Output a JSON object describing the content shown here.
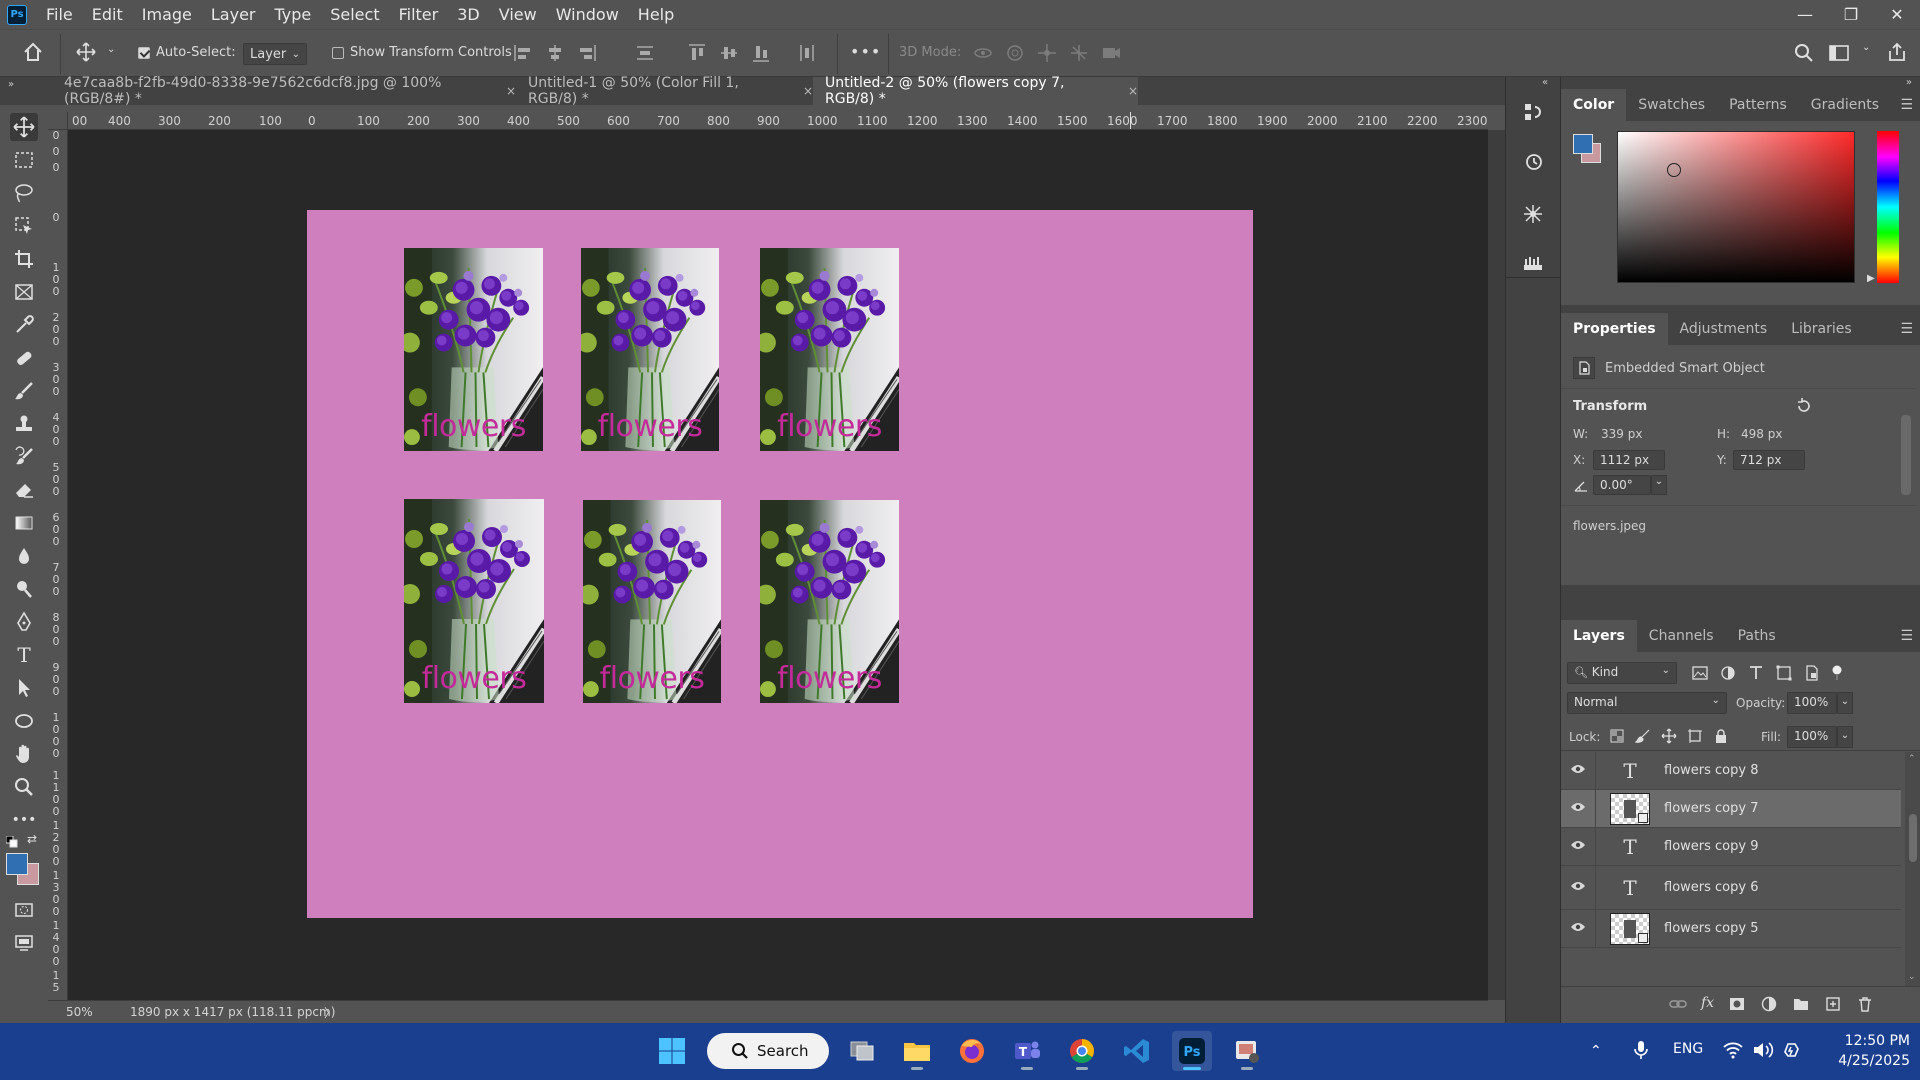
{
  "menubar": {
    "logo": "Ps",
    "items": [
      "File",
      "Edit",
      "Image",
      "Layer",
      "Type",
      "Select",
      "Filter",
      "3D",
      "View",
      "Window",
      "Help"
    ]
  },
  "window_controls": {
    "minimize": "—",
    "restore": "❐",
    "close": "✕"
  },
  "options": {
    "auto_select_label": "Auto-Select:",
    "auto_select_checked": true,
    "target": "Layer",
    "show_transform_label": "Show Transform Controls",
    "show_transform_checked": false,
    "more": "•••",
    "mode_3d_label": "3D Mode:"
  },
  "tabs": [
    {
      "label": "4e7caa8b-f2fb-49d0-8338-9e7562c6dcf8.jpg @ 100% (RGB/8#) *",
      "close": "×",
      "active": false
    },
    {
      "label": "Untitled-1 @ 50% (Color Fill 1, RGB/8) *",
      "close": "×",
      "active": false
    },
    {
      "label": "Untitled-2 @ 50% (flowers copy 7, RGB/8) *",
      "close": "×",
      "active": true
    }
  ],
  "ruler_top": [
    "00",
    "400",
    "300",
    "200",
    "100",
    "0",
    "100",
    "200",
    "300",
    "400",
    "500",
    "600",
    "700",
    "800",
    "900",
    "1000",
    "1100",
    "1200",
    "1300",
    "1400",
    "1500",
    "1600",
    "1700",
    "1800",
    "1900",
    "2000",
    "2100",
    "2200",
    "2300"
  ],
  "ruler_left": [
    "0",
    "0",
    "0",
    "0",
    "1 0 0",
    "2 0 0",
    "3 0 0",
    "4 0 0",
    "5 0 0",
    "6 0 0",
    "7 0 0",
    "8 0 0",
    "9 0 0",
    "1 0 0 0",
    "1 1 0 0",
    "1 2 0 0",
    "1 3 0 0",
    "1 4 0 0",
    "1 5"
  ],
  "artboard": {
    "background": "#d07fbe",
    "photos": [
      {
        "caption": "flowers"
      },
      {
        "caption": "flowers"
      },
      {
        "caption": "flowers"
      },
      {
        "caption": "flowers"
      },
      {
        "caption": "flowers"
      },
      {
        "caption": "flowers"
      }
    ]
  },
  "status": {
    "zoom": "50%",
    "doc_size": "1890 px x 1417 px (118.11 ppcm)",
    "arrow": "〉"
  },
  "color_panel": {
    "tabs": [
      "Color",
      "Swatches",
      "Patterns",
      "Gradients"
    ],
    "active_tab": "Color",
    "foreground": "#2f6fb2",
    "background": "#c89aa0",
    "hue": "#ff2a2a"
  },
  "properties_panel": {
    "tabs": [
      "Properties",
      "Adjustments",
      "Libraries"
    ],
    "active_tab": "Properties",
    "object_type": "Embedded Smart Object",
    "transform_title": "Transform",
    "w_label": "W:",
    "w_value": "339 px",
    "h_label": "H:",
    "h_value": "498 px",
    "x_label": "X:",
    "x_value": "1112 px",
    "y_label": "Y:",
    "y_value": "712 px",
    "angle_value": "0.00°",
    "file_name": "flowers.jpeg"
  },
  "layers_panel": {
    "tabs": [
      "Layers",
      "Channels",
      "Paths"
    ],
    "active_tab": "Layers",
    "filter_kind": "Kind",
    "blend_mode": "Normal",
    "opacity_label": "Opacity:",
    "opacity_value": "100%",
    "lock_label": "Lock:",
    "fill_label": "Fill:",
    "fill_value": "100%",
    "layers": [
      {
        "name": "flowers copy 8",
        "type": "text",
        "selected": false
      },
      {
        "name": "flowers copy 7",
        "type": "smart",
        "selected": true
      },
      {
        "name": "flowers copy 9",
        "type": "text",
        "selected": false
      },
      {
        "name": "flowers copy 6",
        "type": "text",
        "selected": false
      },
      {
        "name": "flowers copy 5",
        "type": "smart",
        "selected": false
      }
    ]
  },
  "taskbar": {
    "search_label": "Search",
    "lang": "ENG",
    "time": "12:50 PM",
    "date": "4/25/2025"
  }
}
